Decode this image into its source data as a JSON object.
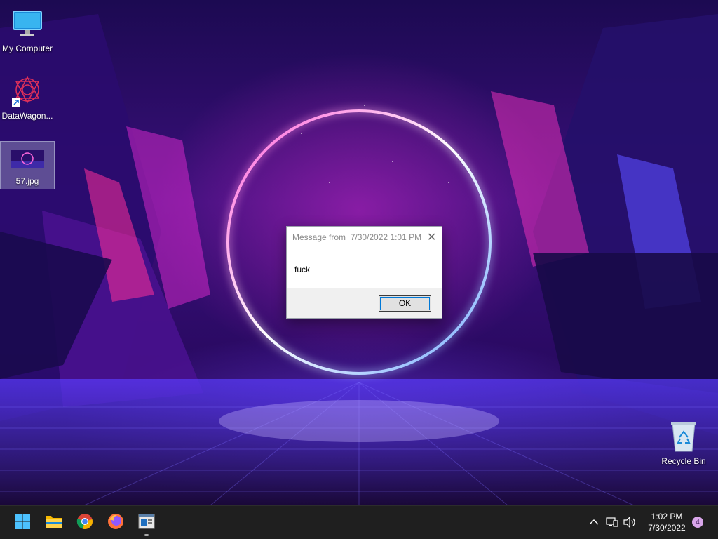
{
  "desktop": {
    "icons": [
      {
        "label": "My Computer",
        "icon": "monitor-icon"
      },
      {
        "label": "DataWagon...",
        "icon": "datawagon-logo-icon"
      },
      {
        "label": "57.jpg",
        "icon": "image-file-icon"
      },
      {
        "label": "Recycle Bin",
        "icon": "recycle-bin-icon"
      }
    ]
  },
  "dialog": {
    "title": "Message from  7/30/2022 1:01 PM",
    "message": "fuck",
    "ok_label": "OK",
    "close_glyph": "✕"
  },
  "taskbar": {
    "apps": [
      {
        "name": "start",
        "icon": "windows-start-icon"
      },
      {
        "name": "file-explorer",
        "icon": "folder-icon"
      },
      {
        "name": "chrome",
        "icon": "chrome-icon"
      },
      {
        "name": "firefox",
        "icon": "firefox-icon"
      },
      {
        "name": "app-window",
        "icon": "app-window-icon",
        "running": true
      }
    ],
    "tray": {
      "chevron": "^",
      "time": "1:02 PM",
      "date": "7/30/2022",
      "notification_count": "4"
    }
  },
  "colors": {
    "accent": "#0078d7",
    "taskbar_bg": "#1f1f1f",
    "badge_bg": "#d9a6ea"
  }
}
